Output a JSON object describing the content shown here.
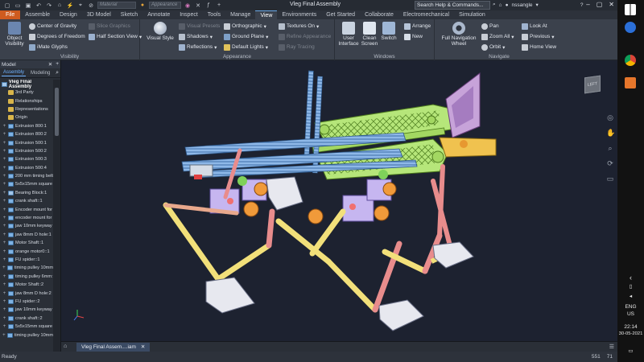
{
  "titlebar": {
    "material_placeholder": "Material",
    "appearance_placeholder": "Appearance",
    "doc_title": "Vleg Final Assembly",
    "search_placeholder": "Search Help & Commands...",
    "username": "nssangle"
  },
  "tabs": [
    "File",
    "Assemble",
    "Design",
    "3D Model",
    "Sketch",
    "Annotate",
    "Inspect",
    "Tools",
    "Manage",
    "View",
    "Environments",
    "Get Started",
    "Collaborate",
    "Electromechanical",
    "Simulation"
  ],
  "active_tab": "View",
  "ribbon": {
    "visibility": {
      "label": "Visibility",
      "object_visibility": "Object Visibility",
      "center_of_gravity": "Center of Gravity",
      "degrees_of_freedom": "Degrees of Freedom",
      "imate_glyphs": "iMate Glyphs",
      "slice_graphics": "Slice Graphics",
      "half_section_view": "Half Section View"
    },
    "appearance": {
      "label": "Appearance",
      "visual_style": "Visual Style",
      "visual_presets": "Visual Presets",
      "shadows": "Shadows",
      "reflections": "Reflections",
      "orthographic": "Orthographic",
      "ground_plane": "Ground Plane",
      "default_lights": "Default Lights",
      "textures_on": "Textures On",
      "refine_appearance": "Refine Appearance",
      "ray_tracing": "Ray Tracing"
    },
    "windows": {
      "label": "Windows",
      "user_interface": "User Interface",
      "clean_screen": "Clean Screen",
      "switch": "Switch",
      "arrange": "Arrange",
      "new": "New"
    },
    "navigate": {
      "label": "Navigate",
      "full_navigation_wheel": "Full Navigation Wheel",
      "pan": "Pan",
      "zoom_all": "Zoom All",
      "orbit": "Orbit",
      "look_at": "Look At",
      "previous": "Previous",
      "home_view": "Home View"
    }
  },
  "browser": {
    "title": "Model",
    "tab_assembly": "Assembly",
    "tab_modeling": "Modeling",
    "root": "Vleg Final Assembly",
    "items": [
      {
        "label": "3rd Party",
        "type": "folder"
      },
      {
        "label": "Relationships",
        "type": "folder"
      },
      {
        "label": "Representations",
        "type": "folder"
      },
      {
        "label": "Origin",
        "type": "folder"
      },
      {
        "label": "Extrusion 800:1",
        "type": "part"
      },
      {
        "label": "Extrusion 800:2",
        "type": "part"
      },
      {
        "label": "Extrusion 500:1",
        "type": "part"
      },
      {
        "label": "Extrusion 500:2",
        "type": "part"
      },
      {
        "label": "Extrusion 500:3",
        "type": "part"
      },
      {
        "label": "Extrusion 500:4",
        "type": "part"
      },
      {
        "label": "200 mm timing belt",
        "type": "part"
      },
      {
        "label": "5x5x15mm square",
        "type": "part"
      },
      {
        "label": "Bearing Block:1",
        "type": "asm"
      },
      {
        "label": "crank shaft::1",
        "type": "part"
      },
      {
        "label": "Encoder mount for",
        "type": "part"
      },
      {
        "label": "encoder mount for",
        "type": "part"
      },
      {
        "label": "jaw 10mm keyway",
        "type": "part"
      },
      {
        "label": "jaw 8mm D hole:1",
        "type": "part"
      },
      {
        "label": "Motor Shaft::1",
        "type": "part"
      },
      {
        "label": "orange motor0::1",
        "type": "part"
      },
      {
        "label": "FU spider::1",
        "type": "part"
      },
      {
        "label": "timing pulley 10mm",
        "type": "part"
      },
      {
        "label": "timing pulley 6mm:",
        "type": "part"
      },
      {
        "label": "Motor Shaft::2",
        "type": "part"
      },
      {
        "label": "jaw 8mm D hole:2",
        "type": "part"
      },
      {
        "label": "FU spider::2",
        "type": "part"
      },
      {
        "label": "jaw 10mm keyway",
        "type": "part"
      },
      {
        "label": "crank shaft::2",
        "type": "part"
      },
      {
        "label": "5x5x15mm square",
        "type": "part"
      },
      {
        "label": "timing pulley 10mm",
        "type": "part"
      }
    ]
  },
  "viewcube_label": "LEFT",
  "doc_tab": "Vleg Final Assem....iam",
  "status": {
    "ready": "Ready",
    "count1": "551",
    "count2": "71"
  },
  "taskbar": {
    "lang1": "ENG",
    "lang2": "US",
    "time": "22:14",
    "date": "30-05-2021"
  }
}
